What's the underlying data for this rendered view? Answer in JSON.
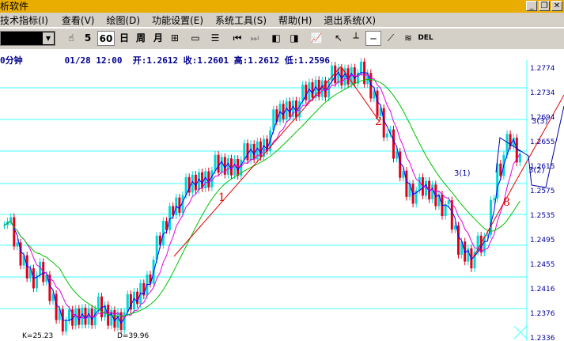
{
  "window": {
    "title": "析软件"
  },
  "window_buttons": [
    "_",
    "❐",
    "✕"
  ],
  "menu": [
    "技术指标(I)",
    "查看(V)",
    "绘图(D)",
    "功能设置(E)",
    "系统工具(S)",
    "帮助(H)",
    "退出系统(X)"
  ],
  "toolbar": {
    "num_5": "5",
    "num_60": "60",
    "day": "日",
    "week": "周",
    "month": "月",
    "del": "DEL"
  },
  "chart_info": {
    "period": "0分钟",
    "date": "01/28",
    "time": "12:00",
    "open": "开:1.2612",
    "close": "收:1.2601",
    "high": "高:1.2612",
    "low": "低:1.2596"
  },
  "indicators": {
    "k": "K=25.23",
    "d": "D=39.96"
  },
  "annotations": {
    "l1": "1",
    "l2": "2",
    "l3a": "3(1)",
    "l3b": "3(3)",
    "l3c": "3(2)",
    "l8": "8"
  },
  "colors": {
    "up": "#00d8d8",
    "down": "#e0001a",
    "ma_blue": "#0000ff",
    "ma_magenta": "#e000e0",
    "ma_green": "#00c000",
    "trend": "#e00000",
    "price_axis": "#0000a0"
  },
  "chart_data": {
    "type": "candlestick",
    "y_axis_ticks": [
      "1.2774",
      "1.2734",
      "1.2694",
      "1.2655",
      "1.2615",
      "1.2575",
      "1.2535",
      "1.2495",
      "1.2455",
      "1.2416",
      "1.2376",
      "1.2336"
    ],
    "ylim": [
      1.2336,
      1.2774
    ],
    "close_path": [
      1.253,
      1.246,
      1.243,
      1.242,
      1.237,
      1.2345,
      1.236,
      1.237,
      1.2355,
      1.236,
      1.238,
      1.242,
      1.248,
      1.254,
      1.256,
      1.258,
      1.2595,
      1.26,
      1.261,
      1.262,
      1.264,
      1.268,
      1.27,
      1.271,
      1.273,
      1.274,
      1.2745,
      1.276,
      1.2735,
      1.269,
      1.262,
      1.257,
      1.256,
      1.256,
      1.254,
      1.247,
      1.246,
      1.247,
      1.26,
      1.264,
      1.26
    ]
  }
}
